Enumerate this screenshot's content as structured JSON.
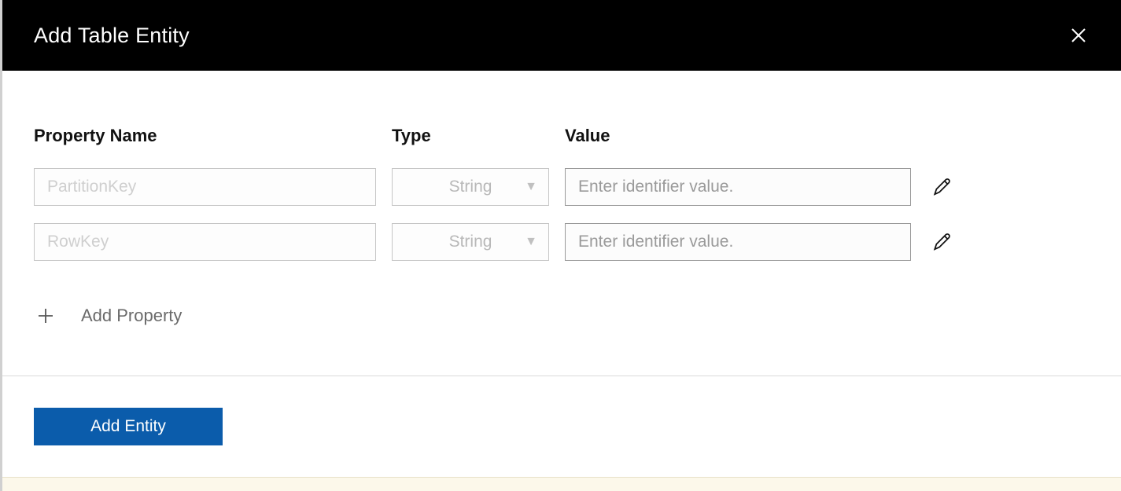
{
  "header": {
    "title": "Add Table Entity",
    "close_label": "Close"
  },
  "columns": {
    "name": "Property Name",
    "type": "Type",
    "value": "Value"
  },
  "rows": [
    {
      "name_placeholder": "PartitionKey",
      "type_display": "String",
      "value_placeholder": "Enter identifier value."
    },
    {
      "name_placeholder": "RowKey",
      "type_display": "String",
      "value_placeholder": "Enter identifier value."
    }
  ],
  "add_property": {
    "label": "Add Property"
  },
  "footer": {
    "add_entity_label": "Add Entity"
  }
}
